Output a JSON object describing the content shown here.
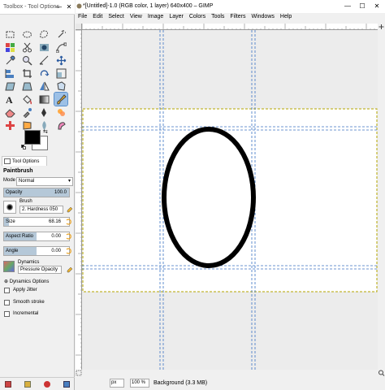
{
  "toolbox": {
    "title": "Toolbox - Tool Options",
    "minimize": "—",
    "close": "✕",
    "tools": [
      "rect-select",
      "ellipse-select",
      "free-select",
      "fuzzy-select",
      "select-by-color",
      "scissors-select",
      "foreground-select",
      "paths",
      "color-picker",
      "zoom",
      "measure",
      "move",
      "align",
      "crop",
      "rotate",
      "scale",
      "shear",
      "perspective",
      "flip",
      "cage",
      "text",
      "bucket-fill",
      "blend",
      "paintbrush",
      "eraser",
      "airbrush",
      "ink",
      "clone",
      "heal",
      "perspective-clone",
      "blur",
      "smudge"
    ],
    "active_tool": "paintbrush",
    "foreground_color": "#000000",
    "background_color": "#ffffff",
    "swap_icon": "⇆",
    "tool_options_tab": "Tool Options",
    "options": {
      "tool_name": "Paintbrush",
      "mode_label": "Mode",
      "mode_value": "Normal",
      "opacity_label": "Opacity",
      "opacity_value": "100.0",
      "brush_label": "Brush",
      "brush_value": "2. Hardness 050",
      "size_label": "Size",
      "size_value": "68.16",
      "aspect_label": "Aspect Ratio",
      "aspect_value": "0.00",
      "angle_label": "Angle",
      "angle_value": "0.00",
      "dynamics_label": "Dynamics",
      "dynamics_value": "Pressure Opacity",
      "dynamics_options": "Dynamics Options",
      "expander_symbol": "⊕",
      "apply_jitter": "Apply Jitter",
      "smooth_stroke": "Smooth stroke",
      "incremental": "Incremental"
    }
  },
  "main": {
    "title": "*[Untitled]-1.0 (RGB color, 1 layer) 640x400 – GIMP",
    "minimize": "—",
    "maximize": "☐",
    "close": "✕",
    "menu": [
      "File",
      "Edit",
      "Select",
      "View",
      "Image",
      "Layer",
      "Colors",
      "Tools",
      "Filters",
      "Windows",
      "Help"
    ],
    "status": {
      "unit": "px",
      "zoom": "100 %",
      "text": "Background (3.3 MB)"
    },
    "colors": {
      "guide": "#3c74c4",
      "layer_boundary": "#b5a600",
      "selection": "#000000",
      "canvas": "#ffffff",
      "padding": "#ececec"
    }
  }
}
